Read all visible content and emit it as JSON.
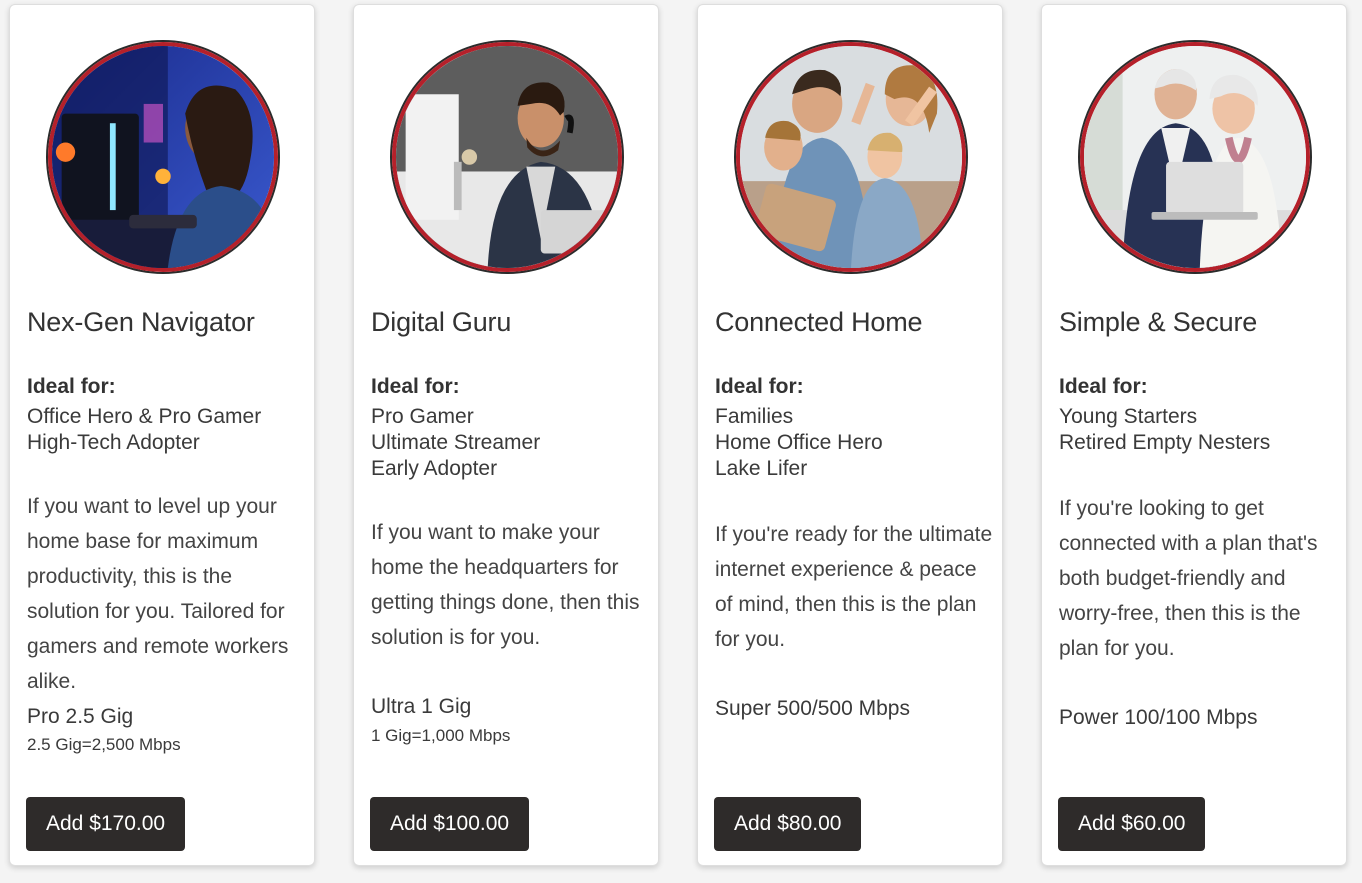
{
  "cards": [
    {
      "title": "Nex-Gen Navigator",
      "ideal_label": "Ideal for:",
      "ideal_for": [
        "Office Hero & Pro Gamer",
        "High-Tech Adopter"
      ],
      "description": "If you want to level up your home base for maximum productivity, this is the solution for you. Tailored for gamers and remote workers alike.",
      "plan": "Pro 2.5 Gig",
      "speed_note": "2.5 Gig=2,500 Mbps",
      "button_label": "Add $170.00",
      "image": "gamer-woman-photo"
    },
    {
      "title": "Digital Guru",
      "ideal_label": "Ideal for:",
      "ideal_for": [
        "Pro Gamer",
        "Ultimate Streamer",
        "Early Adopter"
      ],
      "description": "If you want to make your home the headquarters for getting things done, then this solution is for you.",
      "plan": "Ultra 1 Gig",
      "speed_note": "1 Gig=1,000 Mbps",
      "button_label": "Add $100.00",
      "image": "headset-man-photo"
    },
    {
      "title": "Connected Home",
      "ideal_label": "Ideal for:",
      "ideal_for": [
        "Families",
        "Home Office Hero",
        "Lake Lifer"
      ],
      "description": "If you're ready for the ultimate internet experience & peace of mind, then this is the plan for you.",
      "plan": "Super 500/500 Mbps",
      "button_label": "Add $80.00",
      "image": "family-photo"
    },
    {
      "title": "Simple & Secure",
      "ideal_label": "Ideal for:",
      "ideal_for": [
        "Young Starters",
        "Retired Empty Nesters"
      ],
      "description": "If you're looking to get connected with a plan that's both budget-friendly and worry-free, then this is the plan for you.",
      "plan": "Power 100/100 Mbps",
      "button_label": "Add $60.00",
      "image": "senior-couple-photo"
    }
  ],
  "colors": {
    "accent_ring": "#b5202a",
    "button_bg": "#2e2b2a",
    "button_text": "#ffffff"
  }
}
